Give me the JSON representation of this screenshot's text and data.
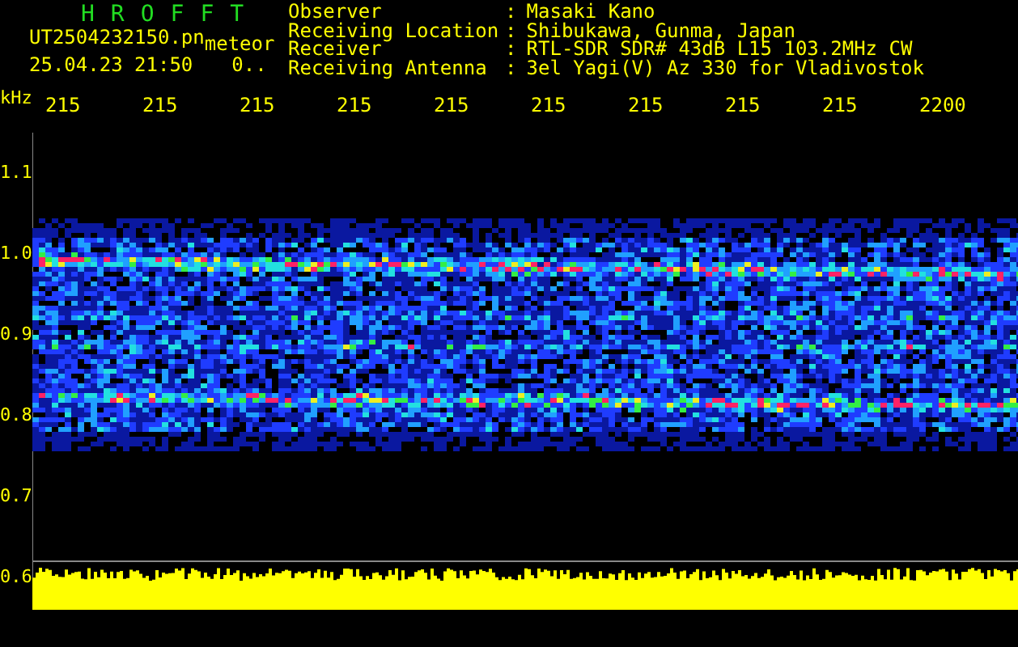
{
  "header": {
    "title": "HROFFT",
    "filename": "UT2504232150.pn",
    "tag": "meteor",
    "datetime": "25.04.23 21:50",
    "status": "0..",
    "info": [
      {
        "label": "Observer",
        "separator": ":",
        "value": "Masaki Kano"
      },
      {
        "label": "Receiving Location",
        "separator": ":",
        "value": "Shibukawa, Gunma, Japan"
      },
      {
        "label": "Receiver",
        "separator": ":",
        "value": "RTL-SDR SDR# 43dB L15 103.2MHz CW"
      },
      {
        "label": "Receiving Antenna",
        "separator": ":",
        "value": "3el Yagi(V) Az 330 for Vladivostok"
      }
    ]
  },
  "x_axis": {
    "unit": "kHz",
    "ticks": [
      "215",
      "215",
      "215",
      "215",
      "215",
      "215",
      "215",
      "215",
      "215",
      "2200"
    ]
  },
  "y_axis": {
    "ticks": [
      "1.1",
      "1.0",
      "0.9",
      "0.8",
      "0.7",
      "0.6"
    ]
  }
}
